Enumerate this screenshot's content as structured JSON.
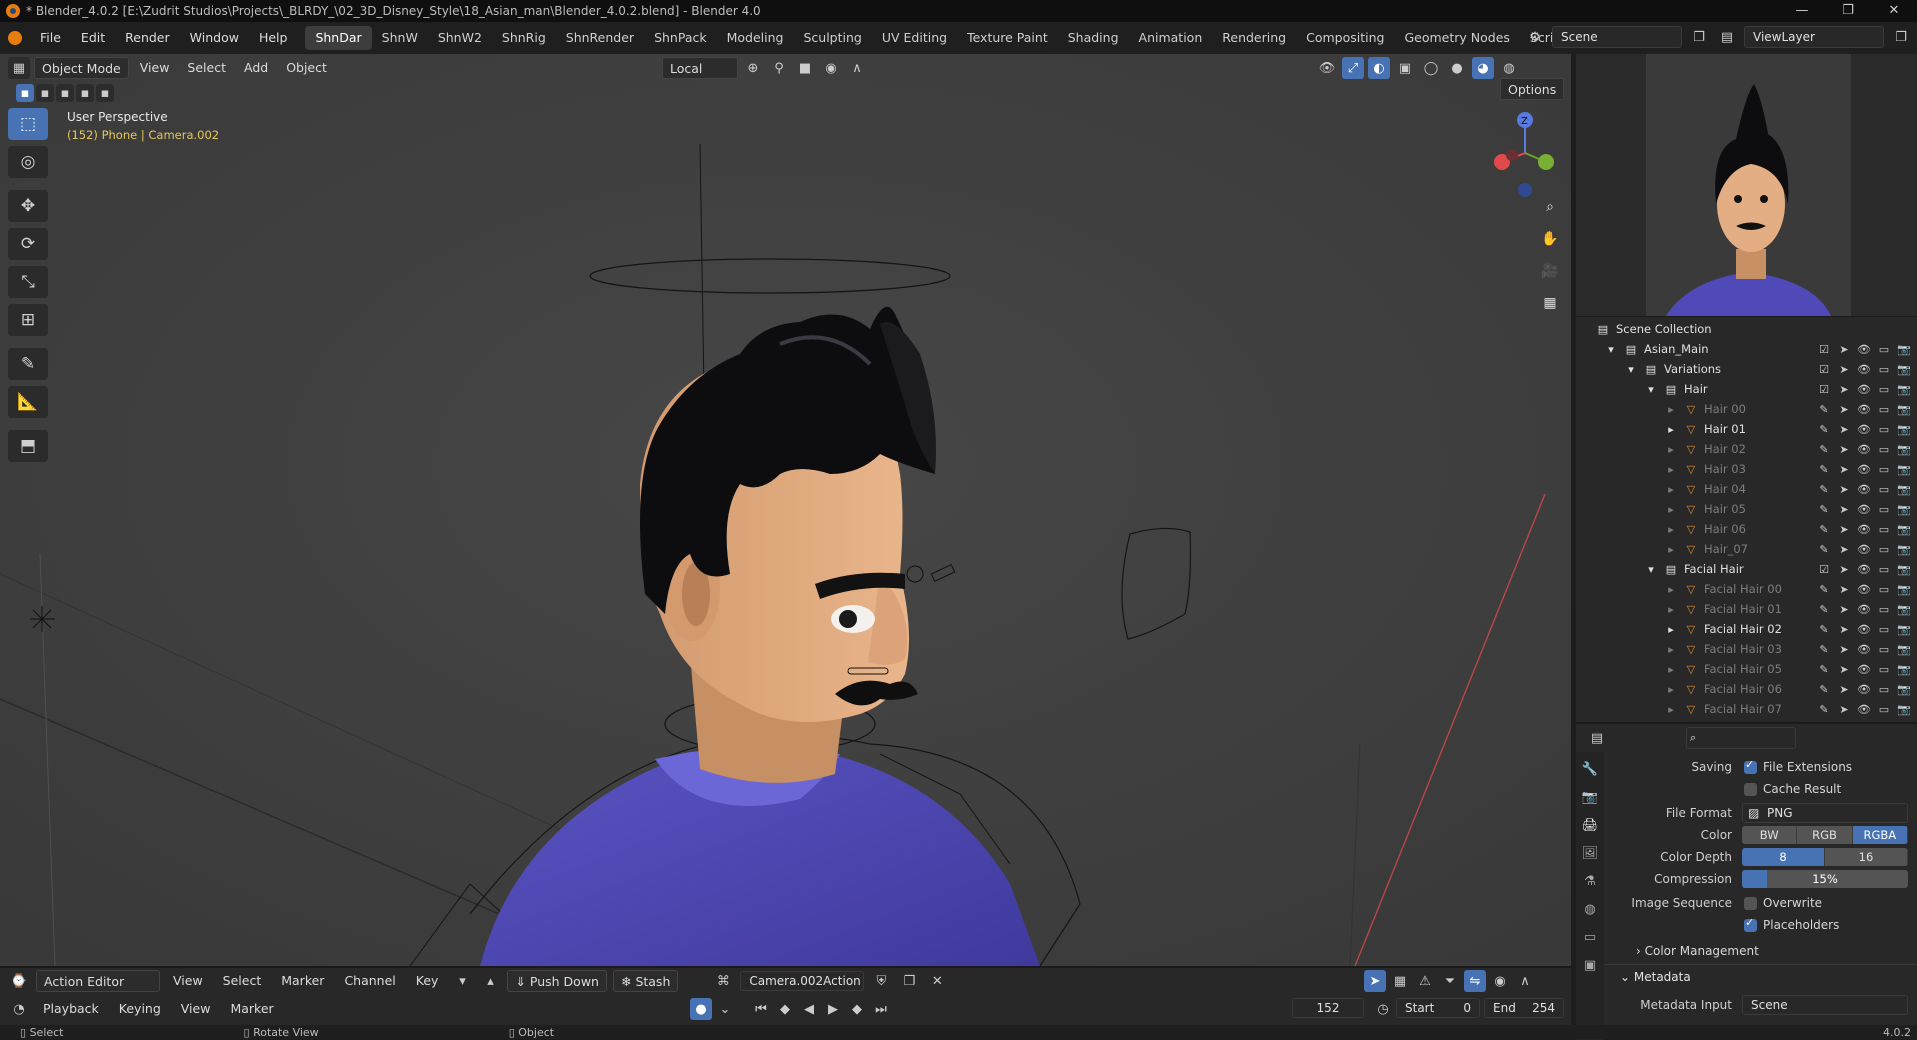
{
  "window": {
    "title": "* Blender_4.0.2 [E:\\Zudrit Studios\\Projects\\_BLRDY_\\02_3D_Disney_Style\\18_Asian_man\\Blender_4.0.2.blend] - Blender 4.0",
    "buttons": [
      "—",
      "❐",
      "✕"
    ]
  },
  "menu": {
    "items": [
      "File",
      "Edit",
      "Render",
      "Window",
      "Help"
    ],
    "workspaces": [
      "ShnDar",
      "ShnW",
      "ShnW2",
      "ShnRig",
      "ShnRender",
      "ShnPack",
      "Modeling",
      "Sculpting",
      "UV Editing",
      "Texture Paint",
      "Shading",
      "Animation",
      "Rendering",
      "Compositing",
      "Geometry Nodes",
      "Scripting"
    ],
    "active_workspace": "ShnDar",
    "add_tab": "+",
    "scene": "Scene",
    "view_layer": "ViewLayer"
  },
  "viewport": {
    "mode": "Object Mode",
    "menus": [
      "View",
      "Select",
      "Add",
      "Object"
    ],
    "transform_orientation": "Local",
    "options": "Options",
    "perspective_label": "User Perspective",
    "object_label": "(152) Phone | Camera.002",
    "gizmo": {
      "z": "Z"
    }
  },
  "outliner": {
    "root": "Scene Collection",
    "rows": [
      {
        "label": "Asian_Main",
        "indent": 0,
        "type": "collection",
        "dim": false
      },
      {
        "label": "Variations",
        "indent": 1,
        "type": "collection",
        "dim": false
      },
      {
        "label": "Hair",
        "indent": 2,
        "type": "collection",
        "dim": false
      },
      {
        "label": "Hair 00",
        "indent": 3,
        "type": "mesh",
        "dim": true
      },
      {
        "label": "Hair 01",
        "indent": 3,
        "type": "mesh",
        "dim": false
      },
      {
        "label": "Hair 02",
        "indent": 3,
        "type": "mesh",
        "dim": true
      },
      {
        "label": "Hair 03",
        "indent": 3,
        "type": "mesh",
        "dim": true
      },
      {
        "label": "Hair 04",
        "indent": 3,
        "type": "mesh",
        "dim": true
      },
      {
        "label": "Hair 05",
        "indent": 3,
        "type": "mesh",
        "dim": true
      },
      {
        "label": "Hair 06",
        "indent": 3,
        "type": "mesh",
        "dim": true
      },
      {
        "label": "Hair_07",
        "indent": 3,
        "type": "mesh",
        "dim": true
      },
      {
        "label": "Facial Hair",
        "indent": 2,
        "type": "collection",
        "dim": false
      },
      {
        "label": "Facial Hair 00",
        "indent": 3,
        "type": "mesh",
        "dim": true
      },
      {
        "label": "Facial Hair 01",
        "indent": 3,
        "type": "mesh",
        "dim": true
      },
      {
        "label": "Facial Hair 02",
        "indent": 3,
        "type": "mesh",
        "dim": false
      },
      {
        "label": "Facial Hair 03",
        "indent": 3,
        "type": "mesh",
        "dim": true
      },
      {
        "label": "Facial Hair 05",
        "indent": 3,
        "type": "mesh",
        "dim": true
      },
      {
        "label": "Facial Hair 06",
        "indent": 3,
        "type": "mesh",
        "dim": true
      },
      {
        "label": "Facial Hair 07",
        "indent": 3,
        "type": "mesh",
        "dim": true
      }
    ]
  },
  "properties": {
    "saving_label": "Saving",
    "file_extensions": "File Extensions",
    "cache_result": "Cache Result",
    "file_format_label": "File Format",
    "file_format": "PNG",
    "color_label": "Color",
    "color_options": [
      "BW",
      "RGB",
      "RGBA"
    ],
    "color_selected": "RGBA",
    "color_depth_label": "Color Depth",
    "color_depth_options": [
      "8",
      "16"
    ],
    "color_depth_selected": "8",
    "compression_label": "Compression",
    "compression": "15%",
    "compression_value": 0.15,
    "image_sequence_label": "Image Sequence",
    "overwrite": "Overwrite",
    "placeholders": "Placeholders",
    "color_management": "Color Management",
    "metadata": "Metadata",
    "metadata_input_label": "Metadata Input",
    "metadata_input": "Scene"
  },
  "timeline": {
    "editor": "Action Editor",
    "menus": [
      "View",
      "Select",
      "Marker",
      "Channel",
      "Key"
    ],
    "push_down": "Push Down",
    "stash": "Stash",
    "action": "Camera.002Action",
    "playback": "Playback",
    "keying": "Keying",
    "menus2": [
      "View",
      "Marker"
    ],
    "current_frame": "152",
    "start_label": "Start",
    "start": "0",
    "end_label": "End",
    "end": "254"
  },
  "status": {
    "items": [
      "Select",
      "Rotate View",
      "Object"
    ],
    "version": "4.0.2"
  }
}
